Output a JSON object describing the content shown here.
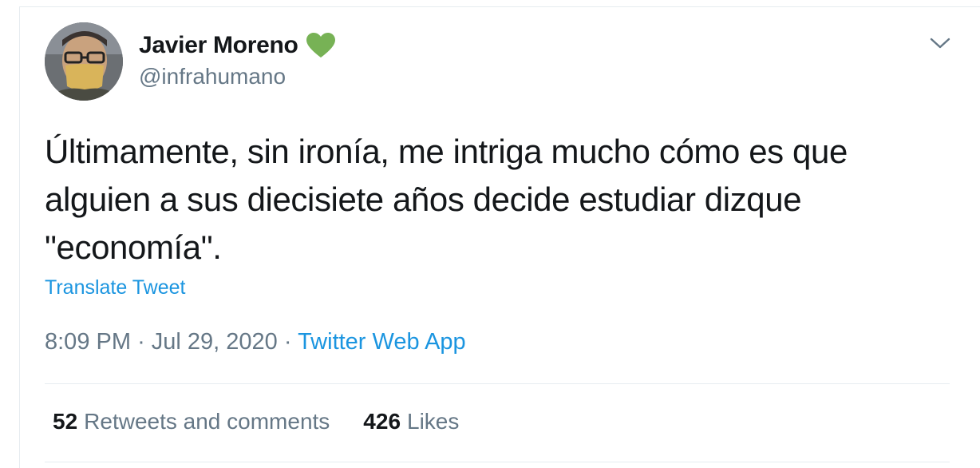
{
  "tweet": {
    "author": {
      "display_name": "Javier Moreno",
      "handle": "@infrahumano",
      "badge_icon": "green-heart-icon",
      "badge_color": "#77b255"
    },
    "text_lines": [
      "Últimamente, sin ironía, me intriga mucho cómo es que",
      "alguien a sus diecisiete años decide estudiar dizque",
      "\"economía\"."
    ],
    "translate_label": "Translate Tweet",
    "time": "8:09 PM",
    "separator": "·",
    "date": "Jul 29, 2020",
    "source": "Twitter Web App",
    "stats": {
      "retweets_count": "52",
      "retweets_label": "Retweets and comments",
      "likes_count": "426",
      "likes_label": "Likes"
    },
    "menu_icon": "chevron-down-icon"
  },
  "colors": {
    "link": "#1b95e0",
    "secondary_text": "#657786",
    "primary_text": "#14171a",
    "border": "#e6ecf0"
  }
}
